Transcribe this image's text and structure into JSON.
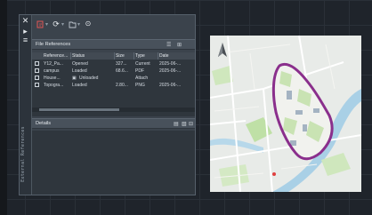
{
  "palette": {
    "vertical_title": "External References",
    "file_references": {
      "title": "File References",
      "columns": [
        "Reference...",
        "Status",
        "Size",
        "Type",
        "Date"
      ],
      "rows": [
        {
          "name": "Y12_Pa...",
          "status": "Opened",
          "size": "327...",
          "type": "Current",
          "date": "2025-06-..."
        },
        {
          "name": "campus",
          "status": "Loaded",
          "size": "68.6...",
          "type": "PDF",
          "date": "2025-06-..."
        },
        {
          "name": "House...",
          "status": "Unloaded",
          "size": "",
          "type": "Attach",
          "date": ""
        },
        {
          "name": "Topogra...",
          "status": "Loaded",
          "size": "2.80...",
          "type": "PNG",
          "date": "2025-06-..."
        }
      ]
    },
    "details": {
      "title": "Details"
    }
  },
  "colors": {
    "workspace": "#1f242b",
    "palette_bg": "#3b434c",
    "accent_red": "#e05555",
    "boundary_purple": "#8a2f8c",
    "water_blue": "#a9d0e6",
    "park_green": "#b9dca0"
  },
  "icons": {
    "close": "close-icon",
    "pin": "pin-icon",
    "attach": "attach-dwg-icon",
    "refresh": "refresh-icon",
    "change_path": "change-path-icon",
    "help": "help-icon",
    "list_view": "list-view-icon",
    "tree_view": "tree-view-icon",
    "north_arrow": "north-arrow-icon"
  }
}
